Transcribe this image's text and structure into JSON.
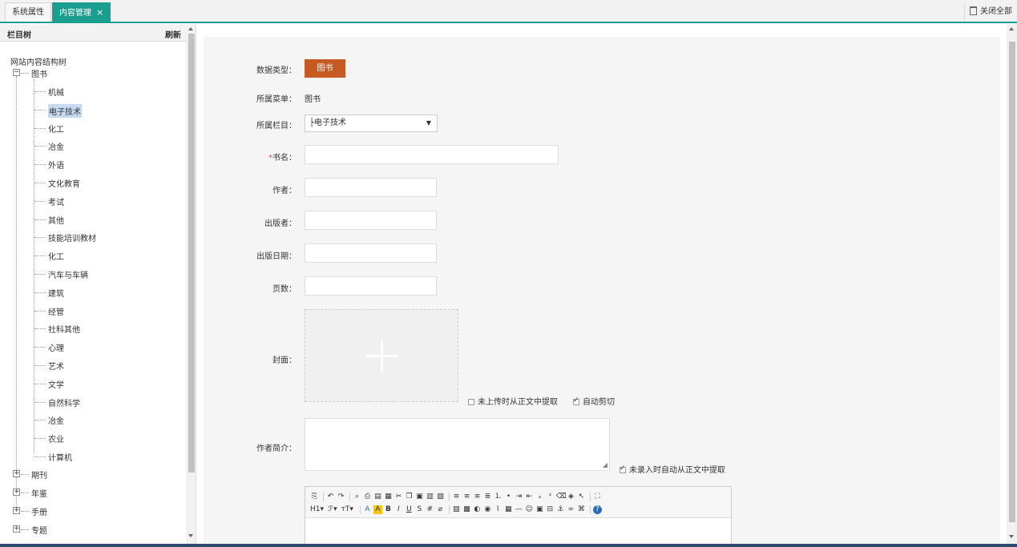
{
  "tabs": [
    {
      "label": "系统属性"
    },
    {
      "label": "内容管理",
      "close": "×"
    }
  ],
  "close_all_label": "关闭全部",
  "sidebar": {
    "title": "栏目树",
    "refresh_label": "刷新",
    "root_label": "网站内容结构树",
    "books": {
      "label": "图书",
      "expander": "−",
      "children": [
        "机械",
        "电子技术",
        "化工",
        "冶金",
        "外语",
        "文化教育",
        "考试",
        "其他",
        "技能培训教材",
        "化工",
        "汽车与车辆",
        "建筑",
        "经管",
        "社科其他",
        "心理",
        "艺术",
        "文学",
        "自然科学",
        "冶金",
        "农业",
        "计算机"
      ],
      "selected_index": 1
    },
    "collapsed": [
      {
        "label": "期刊",
        "expander": "+"
      },
      {
        "label": "年鉴",
        "expander": "+"
      },
      {
        "label": "手册",
        "expander": "+"
      },
      {
        "label": "专题",
        "expander": "+"
      }
    ]
  },
  "form": {
    "data_type_label": "数据类型：",
    "data_type_value": "图书",
    "menu_label": "所属菜单：",
    "menu_value": "图书",
    "column_label": "所属栏目：",
    "column_value": "├电子技术",
    "column_caret": "▼",
    "required_mark": "*",
    "title_label": "书名：",
    "author_label": "作者：",
    "publisher_label": "出版者：",
    "pubdate_label": "出版日期：",
    "pages_label": "页数：",
    "cover_label": "封面：",
    "cover_extract_label": "未上传时从正文中提取",
    "cover_extract_checked": false,
    "auto_crop_label": "自动剪切",
    "auto_crop_checked": true,
    "author_intro_label": "作者简介：",
    "intro_extract_label": "未录入时自动从正文中提取",
    "intro_extract_checked": true
  },
  "editor": {
    "row1": [
      "source-icon",
      "sep",
      "undo-icon",
      "redo-icon",
      "sep",
      "preview-icon",
      "print-icon",
      "template-icon",
      "paste-word-icon",
      "cut-icon",
      "copy-icon",
      "paste-icon",
      "paste-text-icon",
      "paste-word2-icon",
      "sep",
      "align-left-icon",
      "align-center-icon",
      "align-right-icon",
      "justify-icon",
      "ordered-list-icon",
      "unordered-list-icon",
      "indent-icon",
      "outdent-icon",
      "subscript-icon",
      "superscript-icon",
      "clear-format-icon",
      "select-all-icon",
      "pointer-icon",
      "sep",
      "fullscreen-icon"
    ],
    "row2_text": [
      "H1▾",
      "ℱ▾",
      "тT▾"
    ],
    "row2_icons": [
      "font-color-icon",
      "highlight-icon",
      "bold-icon",
      "italic-icon",
      "underline-icon",
      "strike-icon",
      "line-height-icon",
      "eraser-icon",
      "sep",
      "image-icon",
      "multi-image-icon",
      "flash-icon",
      "media-icon",
      "attach-icon",
      "table-icon",
      "hr-icon",
      "emoticon-icon",
      "map-icon",
      "pagebreak-icon",
      "anchor-icon",
      "link-icon",
      "unlink-icon",
      "sep",
      "help-icon"
    ]
  }
}
